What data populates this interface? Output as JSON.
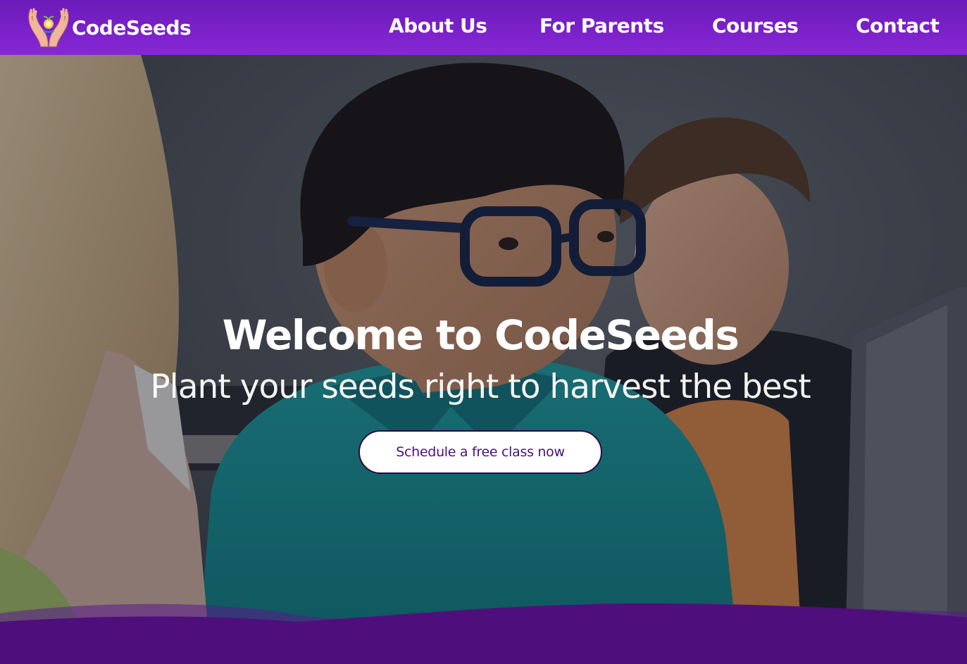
{
  "brand": {
    "name": "CodeSeeds",
    "logo_icon": "hands-seed-icon"
  },
  "nav": {
    "items": [
      {
        "label": "About Us"
      },
      {
        "label": "For Parents"
      },
      {
        "label": "Courses"
      },
      {
        "label": "Contact"
      }
    ]
  },
  "hero": {
    "title": "Welcome to CodeSeeds",
    "subtitle": "Plant your seeds right to harvest the best",
    "cta_label": "Schedule a free class now",
    "background_image": "children-at-computer-photo"
  },
  "colors": {
    "nav_purple": "#7a22c8",
    "wave_purple": "#4e0f7c",
    "cta_text": "#4a1080"
  }
}
